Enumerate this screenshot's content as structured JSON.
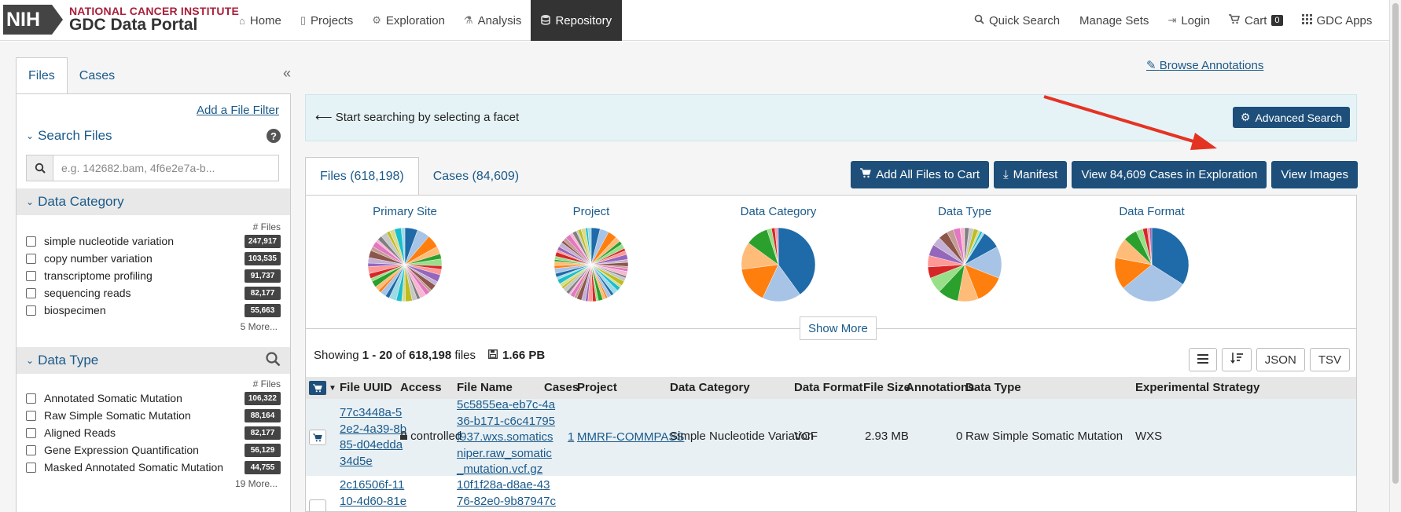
{
  "header": {
    "nih": "NIH",
    "nci": "NATIONAL CANCER INSTITUTE",
    "portal": "GDC Data Portal",
    "nav_left": [
      {
        "label": "Home",
        "icon": "home-icon"
      },
      {
        "label": "Projects",
        "icon": "file-icon"
      },
      {
        "label": "Exploration",
        "icon": "cogs-icon"
      },
      {
        "label": "Analysis",
        "icon": "flask-icon"
      },
      {
        "label": "Repository",
        "icon": "database-icon"
      }
    ],
    "nav_right": [
      {
        "label": "Quick Search",
        "icon": "search-icon"
      },
      {
        "label": "Manage Sets",
        "icon": ""
      },
      {
        "label": "Login",
        "icon": "login-icon"
      },
      {
        "label": "Cart",
        "icon": "cart-icon"
      },
      {
        "label": "GDC Apps",
        "icon": "apps-grid-icon"
      }
    ],
    "cart_count": "0"
  },
  "sidebar": {
    "tabs": [
      "Files",
      "Cases"
    ],
    "collapse": "«",
    "add_filter": "Add a File Filter",
    "search_title": "Search Files",
    "search_placeholder": "e.g. 142682.bam, 4f6e2e7a-b...",
    "facets": [
      {
        "title": "Data Category",
        "files_label": "# Files",
        "items": [
          {
            "label": "simple nucleotide variation",
            "count": "247,917"
          },
          {
            "label": "copy number variation",
            "count": "103,535"
          },
          {
            "label": "transcriptome profiling",
            "count": "91,737"
          },
          {
            "label": "sequencing reads",
            "count": "82,177"
          },
          {
            "label": "biospecimen",
            "count": "55,663"
          }
        ],
        "more": "5 More..."
      },
      {
        "title": "Data Type",
        "files_label": "# Files",
        "items": [
          {
            "label": "Annotated Somatic Mutation",
            "count": "106,322"
          },
          {
            "label": "Raw Simple Somatic Mutation",
            "count": "88,164"
          },
          {
            "label": "Aligned Reads",
            "count": "82,177"
          },
          {
            "label": "Gene Expression Quantification",
            "count": "56,129"
          },
          {
            "label": "Masked Annotated Somatic Mutation",
            "count": "44,755"
          }
        ],
        "more": "19 More..."
      }
    ]
  },
  "main": {
    "browse_annotations": "Browse Annotations",
    "info_text": "Start searching by selecting a facet",
    "advanced_search": "Advanced Search",
    "tabs": [
      "Files (618,198)",
      "Cases (84,609)"
    ],
    "actions": [
      "Add All Files to Cart",
      "Manifest",
      "View 84,609 Cases in Exploration",
      "View Images"
    ],
    "charts": [
      {
        "title": "Primary Site"
      },
      {
        "title": "Project"
      },
      {
        "title": "Data Category"
      },
      {
        "title": "Data Type"
      },
      {
        "title": "Data Format"
      }
    ],
    "show_more": "Show More",
    "showing": {
      "prefix": "Showing ",
      "range": "1 - 20",
      "of": " of ",
      "total": "618,198",
      "suffix": " files"
    },
    "size": "1.66 PB",
    "tools": [
      "JSON",
      "TSV"
    ],
    "columns": [
      "File UUID",
      "Access",
      "File Name",
      "Cases",
      "Project",
      "Data Category",
      "Data Format",
      "File Size",
      "Annotations",
      "Data Type",
      "Experimental Strategy"
    ],
    "rows": [
      {
        "uuid_lines": [
          "77c3448a-5",
          "2e2-4a39-8b",
          "85-d04edda",
          "34d5e"
        ],
        "access": "controlled",
        "name_lines": [
          "5c5855ea-eb7c-4a",
          "36-b171-c6c41795",
          "f937.wxs.somatics",
          "niper.raw_somatic",
          "_mutation.vcf.gz"
        ],
        "cases": "1",
        "project": "MMRF-COMMPASS",
        "category": "Simple Nucleotide Variation",
        "format": "VCF",
        "size": "2.93 MB",
        "annotations": "0",
        "type": "Raw Simple Somatic Mutation",
        "strategy": "WXS"
      },
      {
        "uuid_lines": [
          "2c16506f-11",
          "10-4d60-81e"
        ],
        "name_lines": [
          "10f1f28a-d8ae-43",
          "76-82e0-9b87947c"
        ]
      }
    ]
  },
  "colors": {
    "primary": "#1d4f7a",
    "link": "#1a5a8a",
    "nci_red": "#a8203a",
    "nav_active": "#333333",
    "arrow": "#e53323"
  }
}
